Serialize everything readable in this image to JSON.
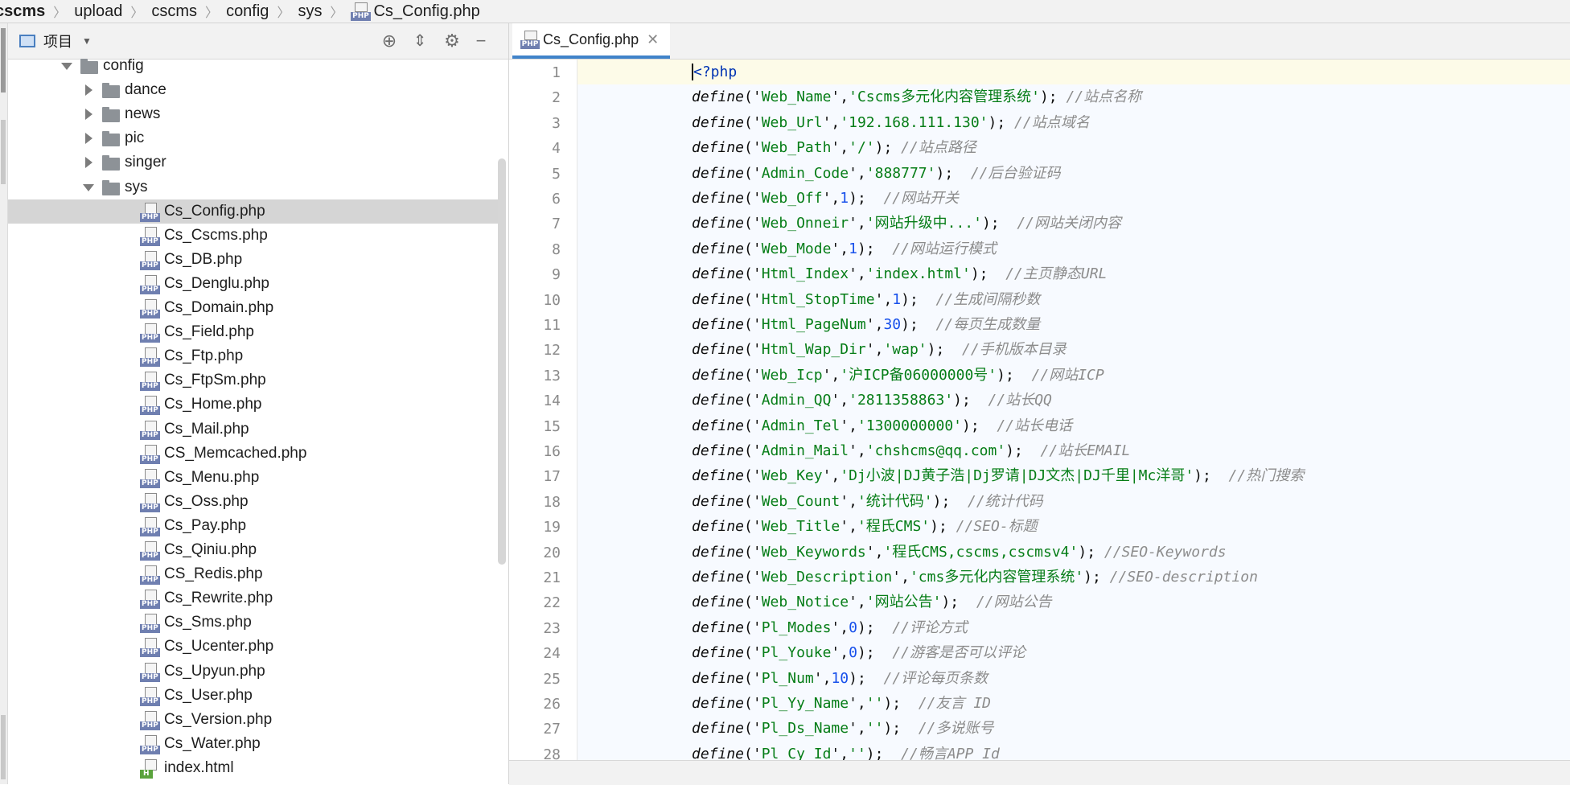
{
  "breadcrumb": {
    "items": [
      "cscms",
      "upload",
      "cscms",
      "config",
      "sys"
    ],
    "file": "Cs_Config.php",
    "file_icon": "php-file-icon"
  },
  "project_panel": {
    "title": "项目",
    "toolbar_icons": [
      "locate-icon",
      "collapse-all-icon",
      "gear-icon",
      "minimize-icon"
    ],
    "tree": [
      {
        "label": "config",
        "type": "folder",
        "expanded": true,
        "depth": 0
      },
      {
        "label": "dance",
        "type": "folder",
        "expanded": false,
        "depth": 1
      },
      {
        "label": "news",
        "type": "folder",
        "expanded": false,
        "depth": 1
      },
      {
        "label": "pic",
        "type": "folder",
        "expanded": false,
        "depth": 1
      },
      {
        "label": "singer",
        "type": "folder",
        "expanded": false,
        "depth": 1
      },
      {
        "label": "sys",
        "type": "folder",
        "expanded": true,
        "depth": 1
      },
      {
        "label": "Cs_Config.php",
        "type": "php",
        "depth": 2,
        "selected": true
      },
      {
        "label": "Cs_Cscms.php",
        "type": "php",
        "depth": 2
      },
      {
        "label": "Cs_DB.php",
        "type": "php",
        "depth": 2
      },
      {
        "label": "Cs_Denglu.php",
        "type": "php",
        "depth": 2
      },
      {
        "label": "Cs_Domain.php",
        "type": "php",
        "depth": 2
      },
      {
        "label": "Cs_Field.php",
        "type": "php",
        "depth": 2
      },
      {
        "label": "Cs_Ftp.php",
        "type": "php",
        "depth": 2
      },
      {
        "label": "Cs_FtpSm.php",
        "type": "php",
        "depth": 2
      },
      {
        "label": "Cs_Home.php",
        "type": "php",
        "depth": 2
      },
      {
        "label": "Cs_Mail.php",
        "type": "php",
        "depth": 2
      },
      {
        "label": "CS_Memcached.php",
        "type": "php",
        "depth": 2
      },
      {
        "label": "Cs_Menu.php",
        "type": "php",
        "depth": 2
      },
      {
        "label": "Cs_Oss.php",
        "type": "php",
        "depth": 2
      },
      {
        "label": "Cs_Pay.php",
        "type": "php",
        "depth": 2
      },
      {
        "label": "Cs_Qiniu.php",
        "type": "php",
        "depth": 2
      },
      {
        "label": "CS_Redis.php",
        "type": "php",
        "depth": 2
      },
      {
        "label": "Cs_Rewrite.php",
        "type": "php",
        "depth": 2
      },
      {
        "label": "Cs_Sms.php",
        "type": "php",
        "depth": 2
      },
      {
        "label": "Cs_Ucenter.php",
        "type": "php",
        "depth": 2
      },
      {
        "label": "Cs_Upyun.php",
        "type": "php",
        "depth": 2
      },
      {
        "label": "Cs_User.php",
        "type": "php",
        "depth": 2
      },
      {
        "label": "Cs_Version.php",
        "type": "php",
        "depth": 2
      },
      {
        "label": "Cs_Water.php",
        "type": "php",
        "depth": 2
      },
      {
        "label": "index.html",
        "type": "html",
        "depth": 2
      }
    ]
  },
  "editor": {
    "tab": {
      "label": "Cs_Config.php",
      "close_icon": "close-icon"
    },
    "open_tag": "<?php",
    "lines": [
      {
        "key": "Web_Name",
        "value": "'Cscms多元化内容管理系统'",
        "vtype": "str",
        "comment": "//站点名称",
        "gap": " "
      },
      {
        "key": "Web_Url",
        "value": "'192.168.111.130'",
        "vtype": "str",
        "comment": "//站点域名",
        "gap": " "
      },
      {
        "key": "Web_Path",
        "value": "'/'",
        "vtype": "str",
        "comment": "//站点路径",
        "gap": " "
      },
      {
        "key": "Admin_Code",
        "value": "'888777'",
        "vtype": "str",
        "comment": "//后台验证码",
        "gap": "  "
      },
      {
        "key": "Web_Off",
        "value": "1",
        "vtype": "num",
        "comment": "//网站开关",
        "gap": "  "
      },
      {
        "key": "Web_Onneir",
        "value": "'网站升级中...'",
        "vtype": "str",
        "comment": "//网站关闭内容",
        "gap": "  "
      },
      {
        "key": "Web_Mode",
        "value": "1",
        "vtype": "num",
        "comment": "//网站运行模式",
        "gap": "  "
      },
      {
        "key": "Html_Index",
        "value": "'index.html'",
        "vtype": "str",
        "comment": "//主页静态URL",
        "gap": "  "
      },
      {
        "key": "Html_StopTime",
        "value": "1",
        "vtype": "num",
        "comment": "//生成间隔秒数",
        "gap": "  "
      },
      {
        "key": "Html_PageNum",
        "value": "30",
        "vtype": "num",
        "comment": "//每页生成数量",
        "gap": "  "
      },
      {
        "key": "Html_Wap_Dir",
        "value": "'wap'",
        "vtype": "str",
        "comment": "//手机版本目录",
        "gap": "  "
      },
      {
        "key": "Web_Icp",
        "value": "'沪ICP备06000000号'",
        "vtype": "str",
        "comment": "//网站ICP",
        "gap": "  "
      },
      {
        "key": "Admin_QQ",
        "value": "'2811358863'",
        "vtype": "str",
        "comment": "//站长QQ",
        "gap": "  "
      },
      {
        "key": "Admin_Tel",
        "value": "'1300000000'",
        "vtype": "str",
        "comment": "//站长电话",
        "gap": "  "
      },
      {
        "key": "Admin_Mail",
        "value": "'chshcms@qq.com'",
        "vtype": "str",
        "comment": "//站长EMAIL",
        "gap": "  "
      },
      {
        "key": "Web_Key",
        "value": "'Dj小波|DJ黄子浩|Dj罗请|DJ文杰|DJ千里|Mc洋哥'",
        "vtype": "str",
        "comment": "//热门搜索",
        "gap": "  "
      },
      {
        "key": "Web_Count",
        "value": "'统计代码'",
        "vtype": "str",
        "comment": "//统计代码",
        "gap": "  "
      },
      {
        "key": "Web_Title",
        "value": "'程氏CMS'",
        "vtype": "str",
        "comment": "//SEO-标题",
        "gap": " "
      },
      {
        "key": "Web_Keywords",
        "value": "'程氏CMS,cscms,cscmsv4'",
        "vtype": "str",
        "comment": "//SEO-Keywords",
        "gap": " "
      },
      {
        "key": "Web_Description",
        "value": "'cms多元化内容管理系统'",
        "vtype": "str",
        "comment": "//SEO-description",
        "gap": " "
      },
      {
        "key": "Web_Notice",
        "value": "'网站公告'",
        "vtype": "str",
        "comment": "//网站公告",
        "gap": "  "
      },
      {
        "key": "Pl_Modes",
        "value": "0",
        "vtype": "num",
        "comment": "//评论方式",
        "gap": "  "
      },
      {
        "key": "Pl_Youke",
        "value": "0",
        "vtype": "num",
        "comment": "//游客是否可以评论",
        "gap": "  "
      },
      {
        "key": "Pl_Num",
        "value": "10",
        "vtype": "num",
        "comment": "//评论每页条数",
        "gap": "  "
      },
      {
        "key": "Pl_Yy_Name",
        "value": "''",
        "vtype": "str",
        "comment": "//友言 ID",
        "gap": "  "
      },
      {
        "key": "Pl_Ds_Name",
        "value": "''",
        "vtype": "str",
        "comment": "//多说账号",
        "gap": "  "
      },
      {
        "key": "Pl_Cy_Id",
        "value": "''",
        "vtype": "str",
        "comment": "//畅言APP_Id",
        "gap": "  "
      }
    ]
  }
}
